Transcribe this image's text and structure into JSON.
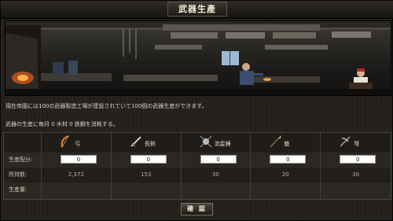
{
  "window": {
    "title": "武器生產"
  },
  "description": {
    "line1": "現在帝國には100の武器製造工場が建設されていて100個の武器生産ができます。",
    "line2": "武器の生産に毎月 0 木材 0 鉄鋼を消耗する。"
  },
  "table": {
    "row_labels": {
      "alloc": "生産配分:",
      "owned": "所持数:",
      "production": "生産量:"
    },
    "weapons": [
      {
        "name": "弓",
        "icon": "bow-icon",
        "alloc": "0",
        "owned": "2,372"
      },
      {
        "name": "長剣",
        "icon": "longsword-icon",
        "alloc": "0",
        "owned": "153"
      },
      {
        "name": "流星錘",
        "icon": "meteor-hammer-icon",
        "alloc": "0",
        "owned": "30"
      },
      {
        "name": "槍",
        "icon": "spear-icon",
        "alloc": "0",
        "owned": "20"
      },
      {
        "name": "弩",
        "icon": "crossbow-icon",
        "alloc": "0",
        "owned": "30"
      }
    ]
  },
  "buttons": {
    "confirm": "確 認"
  }
}
